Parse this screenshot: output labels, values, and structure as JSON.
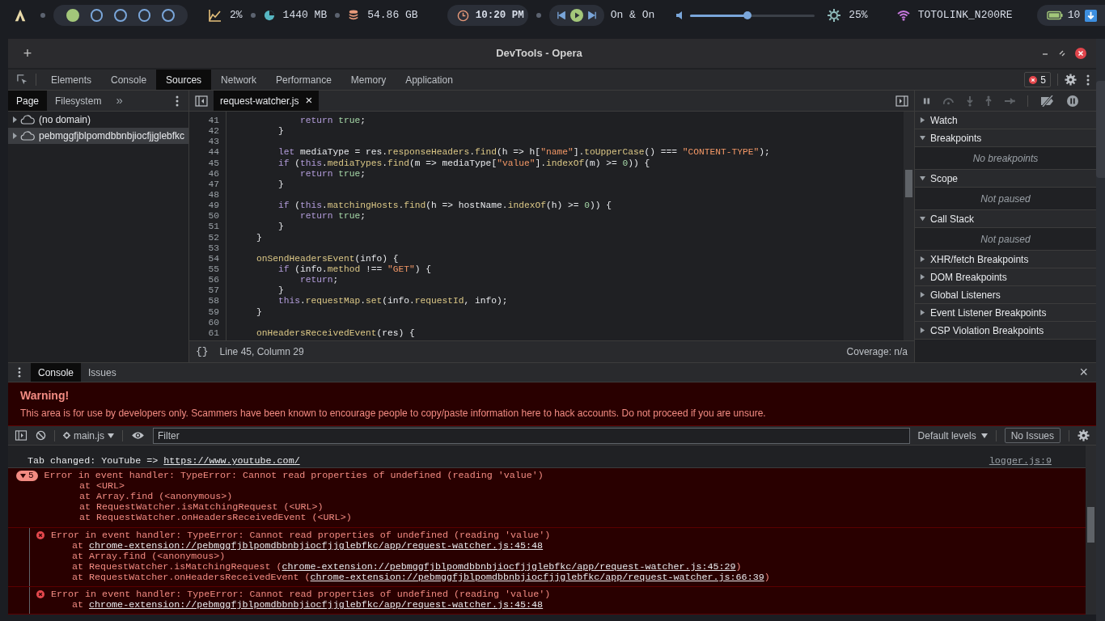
{
  "system_bar": {
    "workspaces": [
      {
        "selected": true
      },
      {
        "selected": false
      },
      {
        "selected": false
      },
      {
        "selected": false
      },
      {
        "selected": false
      }
    ],
    "cpu": "2%",
    "memory": "1440 MB",
    "disk": "54.86 GB",
    "clock": "10:20 PM",
    "media_title": "On & On",
    "volume": {
      "level": 0.46
    },
    "brightness": "25%",
    "wifi": "TOTOLINK_N200RE",
    "battery": "10"
  },
  "window": {
    "title": "DevTools - Opera",
    "new_tab": "+"
  },
  "main_tabs": [
    {
      "label": "Elements",
      "selected": false
    },
    {
      "label": "Console",
      "selected": false
    },
    {
      "label": "Sources",
      "selected": true
    },
    {
      "label": "Network",
      "selected": false
    },
    {
      "label": "Performance",
      "selected": false
    },
    {
      "label": "Memory",
      "selected": false
    },
    {
      "label": "Application",
      "selected": false
    }
  ],
  "error_badge": "5",
  "navigator": {
    "tabs": [
      {
        "label": "Page",
        "selected": true
      },
      {
        "label": "Filesystem",
        "selected": false
      }
    ],
    "more": "»",
    "tree": [
      {
        "label": "(no domain)",
        "selected": false,
        "expanded": false
      },
      {
        "label": "pebmggfjblpomdbbnbjiocfjjglebfkc",
        "selected": true,
        "expanded": false
      }
    ]
  },
  "editor": {
    "tab": {
      "label": "request-watcher.js",
      "close": "×"
    },
    "lines": [
      {
        "number": "41",
        "tokens": [
          {
            "text": "            return",
            "kind": "keyword"
          },
          {
            "text": " true",
            "kind": "literal"
          },
          {
            "text": ";",
            "kind": "plain"
          }
        ]
      },
      {
        "number": "42",
        "tokens": [
          {
            "text": "        }",
            "kind": "plain"
          }
        ]
      },
      {
        "number": "43"
      },
      {
        "number": "44",
        "tokens": [
          {
            "text": "        let",
            "kind": "keyword"
          },
          {
            "text": " mediaType = res.",
            "kind": "plain"
          },
          {
            "text": "responseHeaders",
            "kind": "property"
          },
          {
            "text": ".",
            "kind": "plain"
          },
          {
            "text": "find",
            "kind": "property"
          },
          {
            "text": "(h => h[",
            "kind": "plain"
          },
          {
            "text": "\"name\"",
            "kind": "string"
          },
          {
            "text": "].",
            "kind": "plain"
          },
          {
            "text": "toUpperCase",
            "kind": "property"
          },
          {
            "text": "() === ",
            "kind": "plain"
          },
          {
            "text": "\"CONTENT-TYPE\"",
            "kind": "string"
          },
          {
            "text": ");",
            "kind": "plain"
          }
        ]
      },
      {
        "number": "45",
        "tokens": [
          {
            "text": "        if",
            "kind": "keyword"
          },
          {
            "text": " (",
            "kind": "plain"
          },
          {
            "text": "this",
            "kind": "keyword"
          },
          {
            "text": ".",
            "kind": "plain"
          },
          {
            "text": "mediaTypes",
            "kind": "property"
          },
          {
            "text": ".",
            "kind": "plain"
          },
          {
            "text": "find",
            "kind": "property"
          },
          {
            "text": "(m => mediaType[",
            "kind": "plain"
          },
          {
            "text": "\"value\"",
            "kind": "string"
          },
          {
            "text": "].",
            "kind": "plain"
          },
          {
            "text": "indexOf",
            "kind": "property"
          },
          {
            "text": "(m) >= ",
            "kind": "plain"
          },
          {
            "text": "0",
            "kind": "literal"
          },
          {
            "text": ")) {",
            "kind": "plain"
          }
        ]
      },
      {
        "number": "46",
        "tokens": [
          {
            "text": "            return",
            "kind": "keyword"
          },
          {
            "text": " true",
            "kind": "literal"
          },
          {
            "text": ";",
            "kind": "plain"
          }
        ]
      },
      {
        "number": "47",
        "tokens": [
          {
            "text": "        }",
            "kind": "plain"
          }
        ]
      },
      {
        "number": "48"
      },
      {
        "number": "49",
        "tokens": [
          {
            "text": "        if",
            "kind": "keyword"
          },
          {
            "text": " (",
            "kind": "plain"
          },
          {
            "text": "this",
            "kind": "keyword"
          },
          {
            "text": ".",
            "kind": "plain"
          },
          {
            "text": "matchingHosts",
            "kind": "property"
          },
          {
            "text": ".",
            "kind": "plain"
          },
          {
            "text": "find",
            "kind": "property"
          },
          {
            "text": "(h => hostName.",
            "kind": "plain"
          },
          {
            "text": "indexOf",
            "kind": "property"
          },
          {
            "text": "(h) >= ",
            "kind": "plain"
          },
          {
            "text": "0",
            "kind": "literal"
          },
          {
            "text": ")) {",
            "kind": "plain"
          }
        ]
      },
      {
        "number": "50",
        "tokens": [
          {
            "text": "            return",
            "kind": "keyword"
          },
          {
            "text": " true",
            "kind": "literal"
          },
          {
            "text": ";",
            "kind": "plain"
          }
        ]
      },
      {
        "number": "51",
        "tokens": [
          {
            "text": "        }",
            "kind": "plain"
          }
        ]
      },
      {
        "number": "52",
        "tokens": [
          {
            "text": "    }",
            "kind": "plain"
          }
        ]
      },
      {
        "number": "53"
      },
      {
        "number": "54",
        "tokens": [
          {
            "text": "    onSendHeadersEvent",
            "kind": "property"
          },
          {
            "text": "(info) {",
            "kind": "plain"
          }
        ]
      },
      {
        "number": "55",
        "tokens": [
          {
            "text": "        if",
            "kind": "keyword"
          },
          {
            "text": " (info.",
            "kind": "plain"
          },
          {
            "text": "method",
            "kind": "property"
          },
          {
            "text": " !== ",
            "kind": "plain"
          },
          {
            "text": "\"GET\"",
            "kind": "string"
          },
          {
            "text": ") {",
            "kind": "plain"
          }
        ]
      },
      {
        "number": "56",
        "tokens": [
          {
            "text": "            return",
            "kind": "keyword"
          },
          {
            "text": ";",
            "kind": "plain"
          }
        ]
      },
      {
        "number": "57",
        "tokens": [
          {
            "text": "        }",
            "kind": "plain"
          }
        ]
      },
      {
        "number": "58",
        "tokens": [
          {
            "text": "        this",
            "kind": "keyword"
          },
          {
            "text": ".",
            "kind": "plain"
          },
          {
            "text": "requestMap",
            "kind": "property"
          },
          {
            "text": ".",
            "kind": "plain"
          },
          {
            "text": "set",
            "kind": "property"
          },
          {
            "text": "(info.",
            "kind": "plain"
          },
          {
            "text": "requestId",
            "kind": "property"
          },
          {
            "text": ", info);",
            "kind": "plain"
          }
        ]
      },
      {
        "number": "59",
        "tokens": [
          {
            "text": "    }",
            "kind": "plain"
          }
        ]
      },
      {
        "number": "60"
      },
      {
        "number": "61",
        "tokens": [
          {
            "text": "    onHeadersReceivedEvent",
            "kind": "property"
          },
          {
            "text": "(res) {",
            "kind": "plain"
          }
        ]
      }
    ],
    "status": {
      "format": "{}",
      "position": "Line 45, Column 29",
      "coverage": "Coverage: n/a"
    }
  },
  "debugger": {
    "sections": [
      {
        "title": "Watch",
        "expanded": false
      },
      {
        "title": "Breakpoints",
        "expanded": true,
        "body": "No breakpoints"
      },
      {
        "title": "Scope",
        "expanded": true,
        "body": "Not paused"
      },
      {
        "title": "Call Stack",
        "expanded": true,
        "body": "Not paused"
      },
      {
        "title": "XHR/fetch Breakpoints",
        "expanded": false
      },
      {
        "title": "DOM Breakpoints",
        "expanded": false
      },
      {
        "title": "Global Listeners",
        "expanded": false
      },
      {
        "title": "Event Listener Breakpoints",
        "expanded": false
      },
      {
        "title": "CSP Violation Breakpoints",
        "expanded": false
      }
    ]
  },
  "drawer": {
    "tabs": [
      {
        "label": "Console",
        "selected": true
      },
      {
        "label": "Issues",
        "selected": false
      }
    ],
    "close": "×"
  },
  "console": {
    "warning": {
      "title": "Warning!",
      "text": "This area is for use by developers only. Scammers have been known to encourage people to copy/paste information here to hack accounts. Do not proceed if you are unsure."
    },
    "toolbar": {
      "context": "main.js",
      "filter_placeholder": "Filter",
      "levels": "Default levels",
      "issues": "No Issues"
    },
    "messages": [
      {
        "kind": "info",
        "segments": [
          {
            "text": "Tab changed: YouTube => ",
            "kind": "plain"
          },
          {
            "text": "https://www.youtube.com/",
            "kind": "link"
          }
        ],
        "source": "logger.js:9"
      },
      {
        "kind": "group",
        "count": "5",
        "expanded": true,
        "message": "Error in event handler: TypeError: Cannot read properties of undefined (reading 'value')",
        "frames": [
          [
            {
              "text": "at <URL>",
              "kind": "plain"
            }
          ],
          [
            {
              "text": "at Array.find (<anonymous>)",
              "kind": "plain"
            }
          ],
          [
            {
              "text": "at RequestWatcher.isMatchingRequest (<URL>)",
              "kind": "plain"
            }
          ],
          [
            {
              "text": "at RequestWatcher.onHeadersReceivedEvent (<URL>)",
              "kind": "plain"
            }
          ]
        ]
      },
      {
        "kind": "error",
        "message": "Error in event handler: TypeError: Cannot read properties of undefined (reading 'value')",
        "frames": [
          [
            {
              "text": "at ",
              "kind": "plain"
            },
            {
              "text": "chrome-extension://pebmggfjblpomdbbnbjiocfjjglebfkc/app/request-watcher.js:45:48",
              "kind": "link"
            }
          ],
          [
            {
              "text": "at Array.find (<anonymous>)",
              "kind": "plain"
            }
          ],
          [
            {
              "text": "at RequestWatcher.isMatchingRequest (",
              "kind": "plain"
            },
            {
              "text": "chrome-extension://pebmggfjblpomdbbnbjiocfjjglebfkc/app/request-watcher.js:45:29",
              "kind": "link"
            },
            {
              "text": ")",
              "kind": "plain"
            }
          ],
          [
            {
              "text": "at RequestWatcher.onHeadersReceivedEvent (",
              "kind": "plain"
            },
            {
              "text": "chrome-extension://pebmggfjblpomdbbnbjiocfjjglebfkc/app/request-watcher.js:66:39",
              "kind": "link"
            },
            {
              "text": ")",
              "kind": "plain"
            }
          ]
        ]
      },
      {
        "kind": "error",
        "message": "Error in event handler: TypeError: Cannot read properties of undefined (reading 'value')",
        "frames": [
          [
            {
              "text": "at ",
              "kind": "plain"
            },
            {
              "text": "chrome-extension://pebmggfjblpomdbbnbjiocfjjglebfkc/app/request-watcher.js:45:48",
              "kind": "link"
            }
          ]
        ]
      }
    ]
  }
}
